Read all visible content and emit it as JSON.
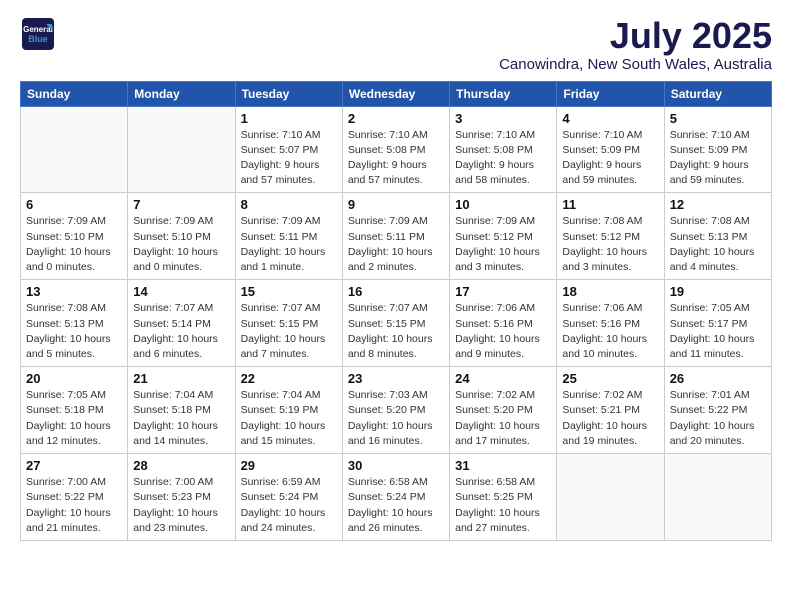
{
  "header": {
    "logo_general": "General",
    "logo_blue": "Blue",
    "month_year": "July 2025",
    "location": "Canowindra, New South Wales, Australia"
  },
  "days_of_week": [
    "Sunday",
    "Monday",
    "Tuesday",
    "Wednesday",
    "Thursday",
    "Friday",
    "Saturday"
  ],
  "weeks": [
    [
      {
        "day": "",
        "info": ""
      },
      {
        "day": "",
        "info": ""
      },
      {
        "day": "1",
        "info": "Sunrise: 7:10 AM\nSunset: 5:07 PM\nDaylight: 9 hours\nand 57 minutes."
      },
      {
        "day": "2",
        "info": "Sunrise: 7:10 AM\nSunset: 5:08 PM\nDaylight: 9 hours\nand 57 minutes."
      },
      {
        "day": "3",
        "info": "Sunrise: 7:10 AM\nSunset: 5:08 PM\nDaylight: 9 hours\nand 58 minutes."
      },
      {
        "day": "4",
        "info": "Sunrise: 7:10 AM\nSunset: 5:09 PM\nDaylight: 9 hours\nand 59 minutes."
      },
      {
        "day": "5",
        "info": "Sunrise: 7:10 AM\nSunset: 5:09 PM\nDaylight: 9 hours\nand 59 minutes."
      }
    ],
    [
      {
        "day": "6",
        "info": "Sunrise: 7:09 AM\nSunset: 5:10 PM\nDaylight: 10 hours\nand 0 minutes."
      },
      {
        "day": "7",
        "info": "Sunrise: 7:09 AM\nSunset: 5:10 PM\nDaylight: 10 hours\nand 0 minutes."
      },
      {
        "day": "8",
        "info": "Sunrise: 7:09 AM\nSunset: 5:11 PM\nDaylight: 10 hours\nand 1 minute."
      },
      {
        "day": "9",
        "info": "Sunrise: 7:09 AM\nSunset: 5:11 PM\nDaylight: 10 hours\nand 2 minutes."
      },
      {
        "day": "10",
        "info": "Sunrise: 7:09 AM\nSunset: 5:12 PM\nDaylight: 10 hours\nand 3 minutes."
      },
      {
        "day": "11",
        "info": "Sunrise: 7:08 AM\nSunset: 5:12 PM\nDaylight: 10 hours\nand 3 minutes."
      },
      {
        "day": "12",
        "info": "Sunrise: 7:08 AM\nSunset: 5:13 PM\nDaylight: 10 hours\nand 4 minutes."
      }
    ],
    [
      {
        "day": "13",
        "info": "Sunrise: 7:08 AM\nSunset: 5:13 PM\nDaylight: 10 hours\nand 5 minutes."
      },
      {
        "day": "14",
        "info": "Sunrise: 7:07 AM\nSunset: 5:14 PM\nDaylight: 10 hours\nand 6 minutes."
      },
      {
        "day": "15",
        "info": "Sunrise: 7:07 AM\nSunset: 5:15 PM\nDaylight: 10 hours\nand 7 minutes."
      },
      {
        "day": "16",
        "info": "Sunrise: 7:07 AM\nSunset: 5:15 PM\nDaylight: 10 hours\nand 8 minutes."
      },
      {
        "day": "17",
        "info": "Sunrise: 7:06 AM\nSunset: 5:16 PM\nDaylight: 10 hours\nand 9 minutes."
      },
      {
        "day": "18",
        "info": "Sunrise: 7:06 AM\nSunset: 5:16 PM\nDaylight: 10 hours\nand 10 minutes."
      },
      {
        "day": "19",
        "info": "Sunrise: 7:05 AM\nSunset: 5:17 PM\nDaylight: 10 hours\nand 11 minutes."
      }
    ],
    [
      {
        "day": "20",
        "info": "Sunrise: 7:05 AM\nSunset: 5:18 PM\nDaylight: 10 hours\nand 12 minutes."
      },
      {
        "day": "21",
        "info": "Sunrise: 7:04 AM\nSunset: 5:18 PM\nDaylight: 10 hours\nand 14 minutes."
      },
      {
        "day": "22",
        "info": "Sunrise: 7:04 AM\nSunset: 5:19 PM\nDaylight: 10 hours\nand 15 minutes."
      },
      {
        "day": "23",
        "info": "Sunrise: 7:03 AM\nSunset: 5:20 PM\nDaylight: 10 hours\nand 16 minutes."
      },
      {
        "day": "24",
        "info": "Sunrise: 7:02 AM\nSunset: 5:20 PM\nDaylight: 10 hours\nand 17 minutes."
      },
      {
        "day": "25",
        "info": "Sunrise: 7:02 AM\nSunset: 5:21 PM\nDaylight: 10 hours\nand 19 minutes."
      },
      {
        "day": "26",
        "info": "Sunrise: 7:01 AM\nSunset: 5:22 PM\nDaylight: 10 hours\nand 20 minutes."
      }
    ],
    [
      {
        "day": "27",
        "info": "Sunrise: 7:00 AM\nSunset: 5:22 PM\nDaylight: 10 hours\nand 21 minutes."
      },
      {
        "day": "28",
        "info": "Sunrise: 7:00 AM\nSunset: 5:23 PM\nDaylight: 10 hours\nand 23 minutes."
      },
      {
        "day": "29",
        "info": "Sunrise: 6:59 AM\nSunset: 5:24 PM\nDaylight: 10 hours\nand 24 minutes."
      },
      {
        "day": "30",
        "info": "Sunrise: 6:58 AM\nSunset: 5:24 PM\nDaylight: 10 hours\nand 26 minutes."
      },
      {
        "day": "31",
        "info": "Sunrise: 6:58 AM\nSunset: 5:25 PM\nDaylight: 10 hours\nand 27 minutes."
      },
      {
        "day": "",
        "info": ""
      },
      {
        "day": "",
        "info": ""
      }
    ]
  ]
}
